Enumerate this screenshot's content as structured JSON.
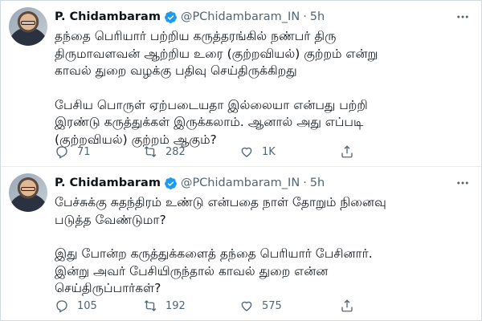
{
  "tweets": [
    {
      "author": "P. Chidambaram",
      "handle": "@PChidambaram_IN",
      "separator": "·",
      "time": "5h",
      "text_lines_1": "தந்தை பெரியார் பற்றிய கருத்தரங்கில் நண்பர் திரு\nதிருமாவளவன் ஆற்றிய உரை (குற்றவியல்) குற்றம் என்று\nகாவல் துறை வழக்கு பதிவு செய்திருக்கிறது",
      "text_lines_2": "பேசிய பொருள் ஏற்படையதா இல்லையா என்பது பற்றி\nஇரண்டு கருத்துக்கள் இருக்கலாம். ஆனால் அது எப்படி\n(குற்றவியல்) குற்றம் ஆகும்?",
      "replies": "71",
      "retweets": "282",
      "likes": "1K"
    },
    {
      "author": "P. Chidambaram",
      "handle": "@PChidambaram_IN",
      "separator": "·",
      "time": "5h",
      "text_lines_1": "பேச்சுக்கு சுதந்திரம் உண்டு என்பதை நாள் தோறும் நினைவு\nபடுத்த வேண்டுமா?",
      "text_lines_2": "இது போன்ற கருத்துக்களைத் தந்தை பெரியார் பேசினார்.\nஇன்று அவர் பேசியிருந்தால் காவல் துறை என்ன\nசெய்திருப்பார்கள்?",
      "replies": "105",
      "retweets": "192",
      "likes": "575"
    }
  ],
  "icons": {
    "verified": "verified-badge-icon",
    "more": "more-icon",
    "reply": "reply-icon",
    "retweet": "retweet-icon",
    "like": "like-icon",
    "share": "share-icon"
  },
  "colors": {
    "verified": "#1d9bf0",
    "secondary_text": "#536471",
    "divider": "#e6ecf0"
  }
}
